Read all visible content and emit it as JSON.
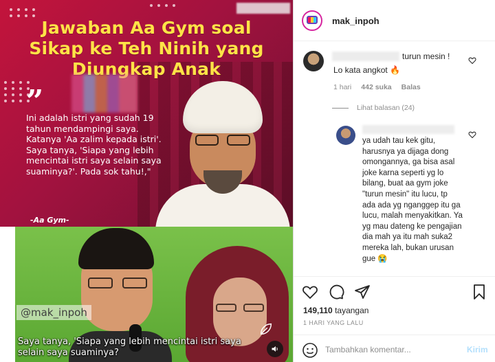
{
  "post": {
    "headline_lines": [
      "Jawaban Aa Gym soal",
      "Sikap ke Teh Ninih yang",
      "Diungkap Anak"
    ],
    "quote_mark": "”",
    "quote_text": "Ini adalah istri yang sudah 19 tahun mendampingi saya. Katanya 'Aa zalim kepada istri'. Saya tanya, 'Siapa yang lebih mencintai istri saya selain saya suaminya?'. Pada sok tahu!,\"",
    "quote_author": "-Aa Gym-",
    "watermark": "@mak_inpoh",
    "video_caption": "Saya tanya, 'Siapa yang lebih mencintai istri saya selain saya suaminya?"
  },
  "header": {
    "username": "mak_inpoh",
    "avatar_icon": "tv-logo-icon"
  },
  "comments": [
    {
      "text_after_name": "turun mesin !",
      "second_line": "Lo kata angkot 🔥",
      "time": "1 hari",
      "likes": "442 suka",
      "reply_label": "Balas",
      "view_replies": "Lihat balasan (24)"
    },
    {
      "body": "ya udah tau kek gitu, harusnya ya dijaga dong omongannya, ga bisa asal joke karna seperti yg lo bilang, buat aa gym joke \"turun mesin\" itu lucu, tp ada ada yg nganggep itu ga lucu, malah menyakitkan. Ya yg mau dateng ke pengajian dia mah ya itu mah suka2 mereka lah, bukan urusan gue 😭"
    }
  ],
  "actions": {
    "views_count": "149,110",
    "views_label": "tayangan",
    "date": "1 HARI YANG LALU",
    "comment_placeholder": "Tambahkan komentar...",
    "send_label": "Kirim"
  },
  "colors": {
    "poster_red": "#c3143c",
    "headline_yellow": "#ffe347",
    "photo_green": "#5aa732",
    "send_blue": "#b2dffc",
    "meta_gray": "#8e8e8e"
  }
}
